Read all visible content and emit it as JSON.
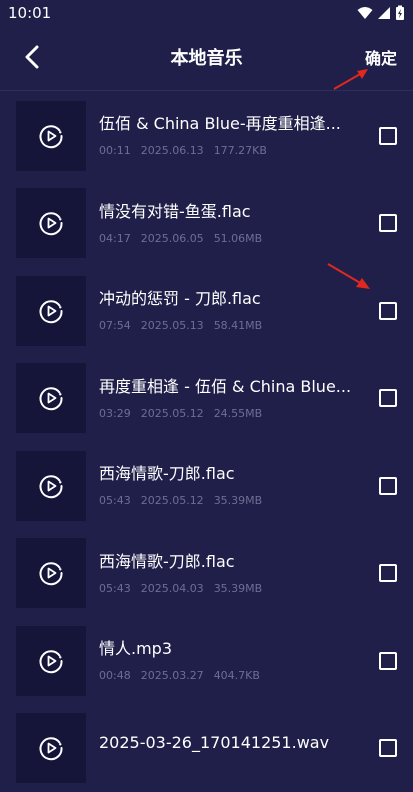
{
  "status": {
    "time": "10:01"
  },
  "header": {
    "back_icon": "chevron-left-icon",
    "title": "本地音乐",
    "confirm_label": "确定"
  },
  "colors": {
    "background": "#1f1f4a",
    "thumb": "#15153a",
    "meta": "#6e6e93",
    "annotation": "#e0281e"
  },
  "items": [
    {
      "name": "伍佰 & China Blue-再度重相逢...",
      "duration": "00:11",
      "date": "2025.06.13",
      "size": "177.27KB"
    },
    {
      "name": "情没有对错-鱼蛋.flac",
      "duration": "04:17",
      "date": "2025.06.05",
      "size": "51.06MB"
    },
    {
      "name": "冲动的惩罚 - 刀郎.flac",
      "duration": "07:54",
      "date": "2025.05.13",
      "size": "58.41MB"
    },
    {
      "name": "再度重相逢 - 伍佰 & China Blue...",
      "duration": "03:29",
      "date": "2025.05.12",
      "size": "24.55MB"
    },
    {
      "name": "西海情歌-刀郎.flac",
      "duration": "05:43",
      "date": "2025.05.12",
      "size": "35.39MB"
    },
    {
      "name": "西海情歌-刀郎.flac",
      "duration": "05:43",
      "date": "2025.04.03",
      "size": "35.39MB"
    },
    {
      "name": "情人.mp3",
      "duration": "00:48",
      "date": "2025.03.27",
      "size": "404.7KB"
    },
    {
      "name": "2025-03-26_170141251.wav",
      "duration": "",
      "date": "",
      "size": ""
    }
  ]
}
